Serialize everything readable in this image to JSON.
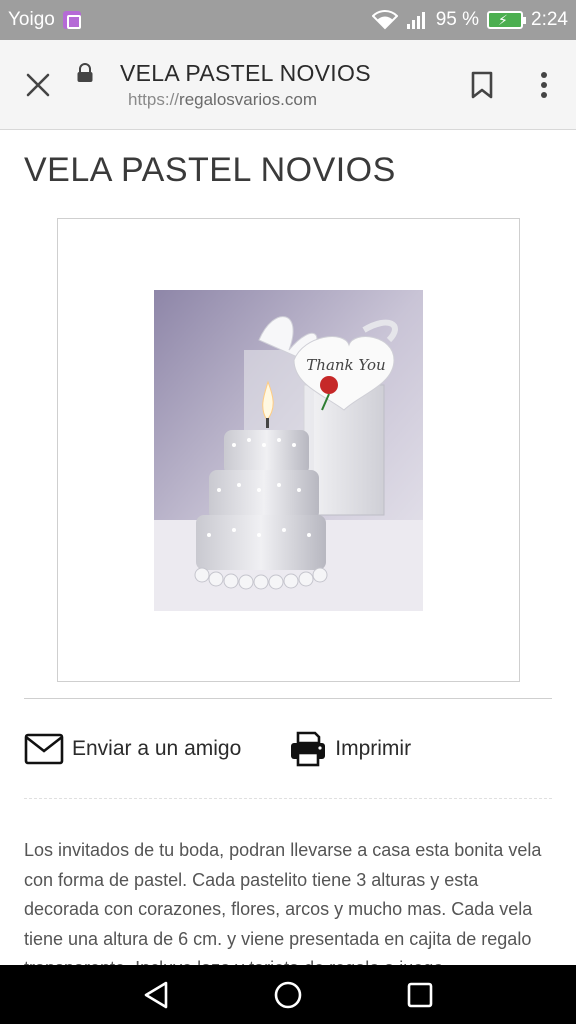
{
  "status_bar": {
    "carrier": "Yoigo",
    "battery_percent": "95 %",
    "time": "2:24",
    "icons": [
      "carrier-app-icon",
      "wifi-icon",
      "signal-icon",
      "battery-charging-icon"
    ]
  },
  "toolbar": {
    "title": "VELA PASTEL NOVIOS",
    "url_scheme": "https://",
    "url_host": "regalosvarios.com",
    "icons": [
      "close-icon",
      "lock-icon",
      "bookmark-icon",
      "more-vert-icon"
    ]
  },
  "page": {
    "title": "VELA PASTEL NOVIOS",
    "image_tag_text": "Thank You",
    "actions": {
      "email_label": "Enviar a un amigo",
      "print_label": "Imprimir"
    },
    "description": " Los invitados de tu boda, podran llevarse a casa esta bonita vela con forma de pastel. Cada pastelito tiene 3 alturas y esta decorada con corazones, flores, arcos y mucho mas. Cada vela tiene una altura de 6 cm. y viene presentada en cajita de regalo transparente. Incluye lazo y tarjeta de regalo a juego"
  },
  "nav_bar": {
    "icons": [
      "back-icon",
      "home-icon",
      "recents-icon"
    ]
  },
  "colors": {
    "status_bar": "#9e9e9e",
    "toolbar": "#f5f5f5",
    "battery": "#4caf50",
    "carrier_badge": "#b56ad6"
  }
}
